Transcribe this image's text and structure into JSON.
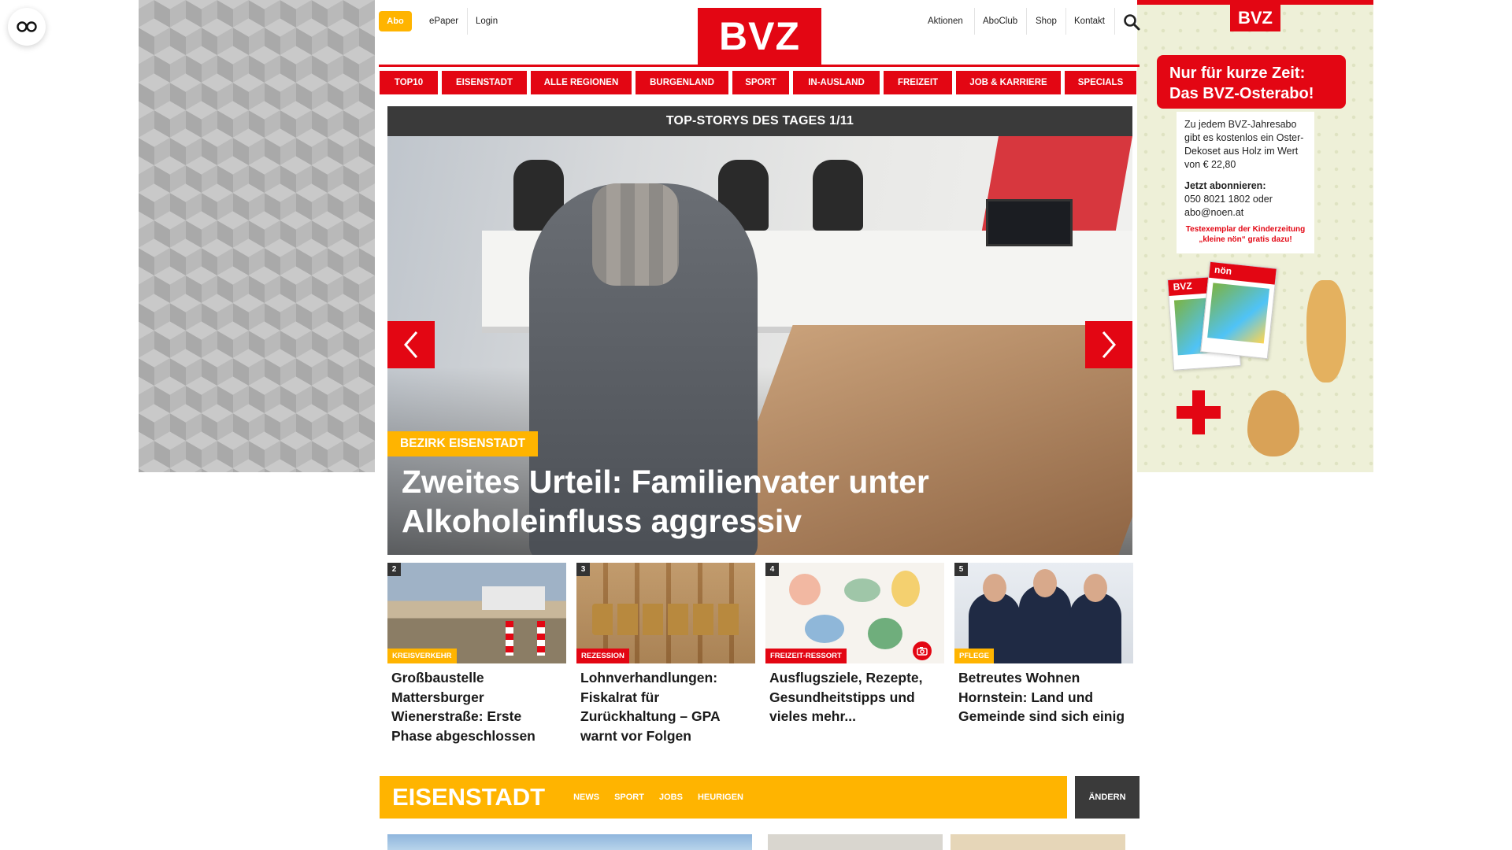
{
  "header": {
    "abo_label": "Abo",
    "links": [
      "ePaper",
      "Login"
    ],
    "logo_text": "BVZ",
    "right_links": [
      "Aktionen",
      "AboClub",
      "Shop",
      "Kontakt"
    ],
    "search_icon": "search-icon"
  },
  "nav": {
    "items": [
      "TOP10",
      "EISENSTADT",
      "ALLE REGIONEN",
      "BURGENLAND",
      "SPORT",
      "IN-AUSLAND",
      "FREIZEIT",
      "JOB & KARRIERE",
      "SPECIALS"
    ]
  },
  "hero": {
    "heading": "TOP-STORYS DES TAGES 1/11",
    "category": "BEZIRK EISENSTADT",
    "title": "Zweites Urteil: Familienvater unter Alkoholeinfluss aggressiv"
  },
  "teasers": [
    {
      "num": "2",
      "category": "KREISVERKEHR",
      "title": "Großbaustelle Mattersburger Wienerstraße: Erste Phase abgeschlossen",
      "cat_color": "#ffb400"
    },
    {
      "num": "3",
      "category": "REZESSION",
      "title": "Lohnverhandlungen: Fiskalrat für Zurückhaltung – GPA warnt vor Folgen",
      "cat_color": "#e30613"
    },
    {
      "num": "4",
      "category": "FREIZEIT-RESSORT",
      "title": "Ausflugsziele, Rezepte, Gesundheitstipps und vieles mehr...",
      "cat_color": "#e30613"
    },
    {
      "num": "5",
      "category": "PFLEGE",
      "title": "Betreutes Wohnen Hornstein: Land und Gemeinde sind sich einig",
      "cat_color": "#ffb400"
    }
  ],
  "region": {
    "title": "EISENSTADT",
    "links": [
      "NEWS",
      "SPORT",
      "JOBS",
      "HEURIGEN"
    ],
    "change_label": "ÄNDERN"
  },
  "ad": {
    "logo": "BVZ",
    "banner": "Nur für kurze Zeit: Das BVZ-Osterabo!",
    "text": "Zu jedem BVZ-Jahresabo gibt es kostenlos ein Oster-Dekoset aus Holz im Wert von € 22,80",
    "cta_title": "Jetzt abonnieren:",
    "cta_text": "050 8021 1802 oder abo@noen.at",
    "note": "Testexemplar der Kinderzeitung „kleine nön“ gratis dazu!",
    "mag1": "BVZ",
    "mag2": "nön"
  },
  "colors": {
    "brand_red": "#e30613",
    "accent_yellow": "#ffb400",
    "dark": "#3a3a3a"
  }
}
